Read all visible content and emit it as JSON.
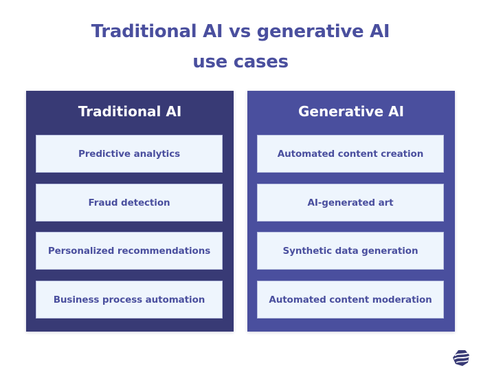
{
  "title": {
    "line1": "Traditional AI vs generative AI",
    "line2": "use cases"
  },
  "columns": [
    {
      "heading": "Traditional AI",
      "color": "#383a75",
      "items": [
        "Predictive analytics",
        "Fraud detection",
        "Personalized recommendations",
        "Business process automation"
      ]
    },
    {
      "heading": "Generative AI",
      "color": "#4a4f9e",
      "items": [
        "Automated content creation",
        "AI-generated art",
        "Synthetic data generation",
        "Automated content moderation"
      ]
    }
  ],
  "logo": {
    "icon": "brand-logo-icon"
  }
}
